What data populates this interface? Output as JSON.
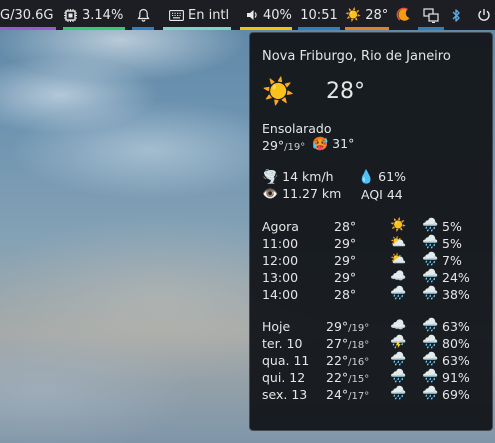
{
  "topbar": {
    "memory": "G/30.6G",
    "cpu": "3.14%",
    "keyboard": "En intl",
    "volume": "40%",
    "time": "10:51",
    "weather_temp": "28°",
    "colors": {
      "memory_underline": "#9b59d0",
      "cpu_underline": "#2ecc71",
      "bell_underline": "#2d7fbf",
      "keyboard_underline": "#7fd6c4",
      "volume_underline": "#f1c40f",
      "time_underline": "#2d7fbf",
      "weather_underline": "#e67e22",
      "net_underline": "#2d7fbf"
    }
  },
  "weather": {
    "location": "Nova Friburgo, Rio de Janeiro",
    "current_temp": "28°",
    "current_icon": "sun-icon",
    "condition": "Ensolarado",
    "high": "29°",
    "low": "/19°",
    "feels_like": "31°",
    "wind": "14 km/h",
    "humidity": "61%",
    "visibility": "11.27 km",
    "aqi": "AQI 44",
    "hourly": [
      {
        "label": "Agora",
        "temp": "28°",
        "icon": "sun-icon",
        "rain": "5%"
      },
      {
        "label": "11:00",
        "temp": "29°",
        "icon": "partly-cloudy-icon",
        "rain": "5%"
      },
      {
        "label": "12:00",
        "temp": "29°",
        "icon": "partly-cloudy-icon",
        "rain": "7%"
      },
      {
        "label": "13:00",
        "temp": "29°",
        "icon": "cloud-icon",
        "rain": "24%"
      },
      {
        "label": "14:00",
        "temp": "28°",
        "icon": "rain-cloud-icon",
        "rain": "38%"
      }
    ],
    "daily": [
      {
        "label": "Hoje",
        "high": "29°",
        "low": "/19°",
        "icon": "cloud-icon",
        "rain": "63%"
      },
      {
        "label": "ter. 10",
        "high": "27°",
        "low": "/18°",
        "icon": "thunder-cloud-icon",
        "rain": "80%"
      },
      {
        "label": "qua. 11",
        "high": "22°",
        "low": "/16°",
        "icon": "rain-cloud-icon",
        "rain": "63%"
      },
      {
        "label": "qui. 12",
        "high": "22°",
        "low": "/15°",
        "icon": "rain-cloud-icon",
        "rain": "91%"
      },
      {
        "label": "sex. 13",
        "high": "24°",
        "low": "/17°",
        "icon": "rain-cloud-icon",
        "rain": "69%"
      }
    ]
  }
}
